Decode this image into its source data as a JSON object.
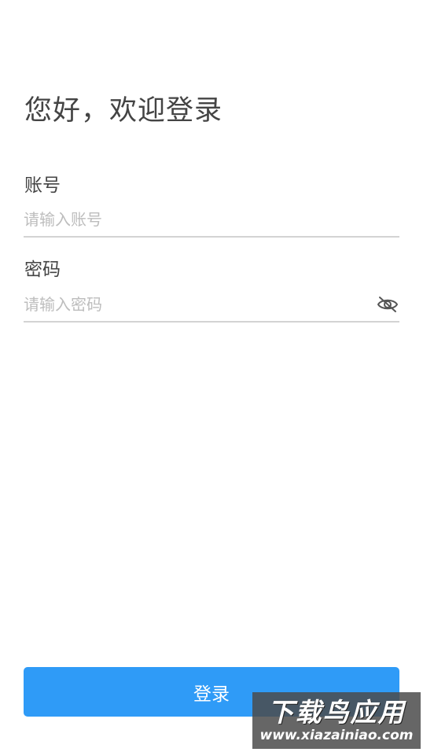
{
  "header": {
    "welcome": "您好，欢迎登录"
  },
  "form": {
    "account": {
      "label": "账号",
      "placeholder": "请输入账号",
      "value": ""
    },
    "password": {
      "label": "密码",
      "placeholder": "请输入密码",
      "value": "",
      "visibility_icon": "eye-off-icon"
    }
  },
  "actions": {
    "login_label": "登录"
  },
  "colors": {
    "accent": "#2f9bf7",
    "divider": "#d3d3d3",
    "text": "#444444",
    "placeholder": "#bdbdbd"
  },
  "watermark": {
    "brand": "下载鸟应用",
    "url": "www.xiazainiao.com"
  }
}
